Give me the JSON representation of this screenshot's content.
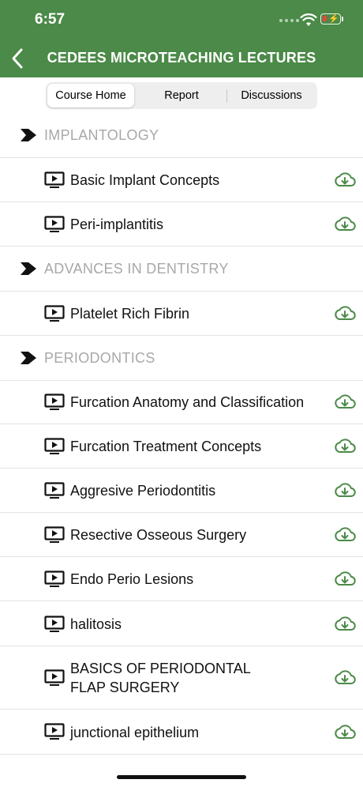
{
  "status": {
    "time": "6:57"
  },
  "header": {
    "title": "CEDEES MICROTEACHING LECTURES"
  },
  "tabs": [
    {
      "label": "Course Home",
      "active": true
    },
    {
      "label": "Report",
      "active": false
    },
    {
      "label": "Discussions",
      "active": false
    }
  ],
  "sections": [
    {
      "title": "IMPLANTOLOGY",
      "items": [
        {
          "label": "Basic Implant Concepts"
        },
        {
          "label": "Peri-implantitis"
        }
      ]
    },
    {
      "title": "ADVANCES IN DENTISTRY",
      "items": [
        {
          "label": "Platelet Rich Fibrin"
        }
      ]
    },
    {
      "title": "PERIODONTICS",
      "items": [
        {
          "label": "Furcation Anatomy and Classification"
        },
        {
          "label": "Furcation Treatment Concepts"
        },
        {
          "label": "Aggresive Periodontitis"
        },
        {
          "label": "Resective Osseous Surgery"
        },
        {
          "label": "Endo Perio Lesions"
        },
        {
          "label": "halitosis"
        },
        {
          "label": "BASICS OF PERIODONTAL\nFLAP SURGERY"
        },
        {
          "label": "junctional epithelium"
        }
      ]
    }
  ],
  "icons": {
    "back": "chevron-left-icon",
    "section": "chevron-right-icon",
    "lecture": "play-video-icon",
    "download": "cloud-download-icon"
  },
  "colors": {
    "brand": "#4b8a48",
    "section_text": "#a8a8a8",
    "download": "#4b8a48"
  }
}
